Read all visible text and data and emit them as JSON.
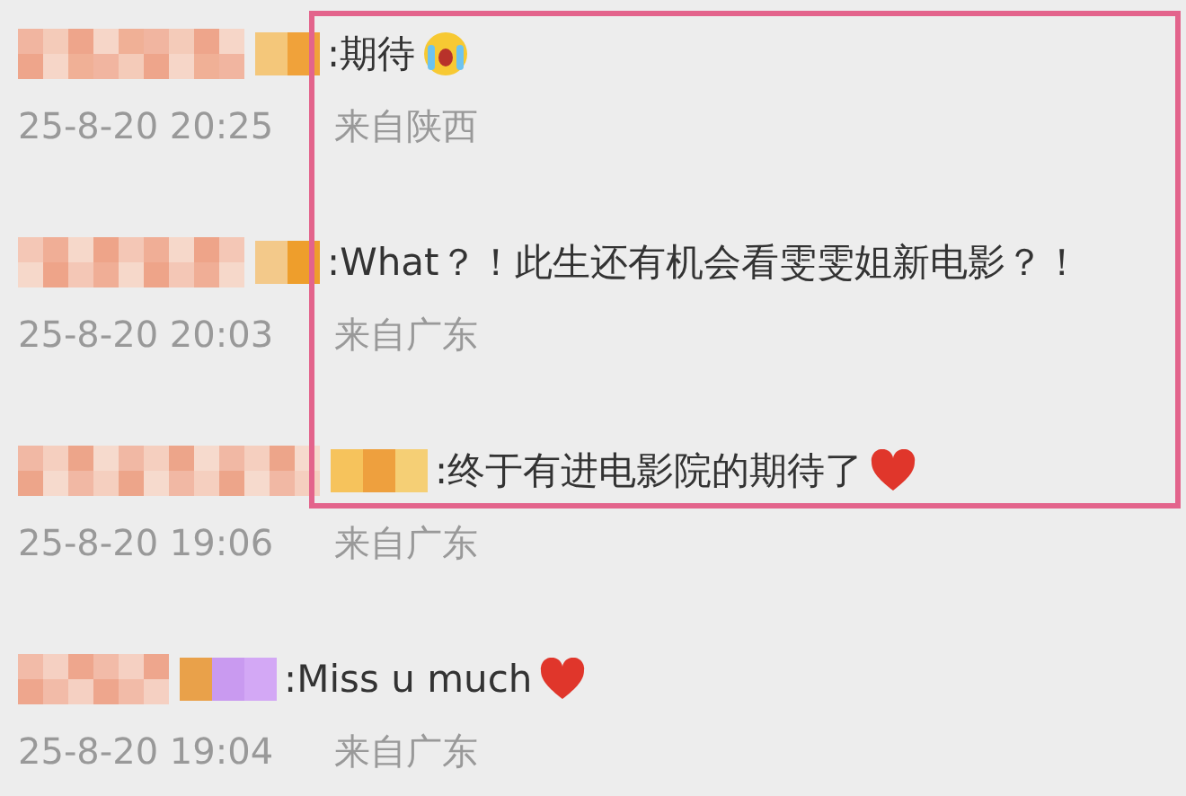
{
  "comments": [
    {
      "kind": "crying",
      "text": ":期待",
      "time": "25-8-20 20:25",
      "location": "来自陕西"
    },
    {
      "kind": "plain",
      "text": ":What？！此生还有机会看雯雯姐新电影？！",
      "time": "25-8-20 20:03",
      "location": "来自广东"
    },
    {
      "kind": "heart",
      "text": ":终于有进电影院的期待了",
      "time": "25-8-20 19:06",
      "location": "来自广东"
    },
    {
      "kind": "heart",
      "text": ":Miss u much",
      "time": "25-8-20 19:04",
      "location": "来自广东"
    }
  ],
  "highlight": {
    "shown": true
  }
}
